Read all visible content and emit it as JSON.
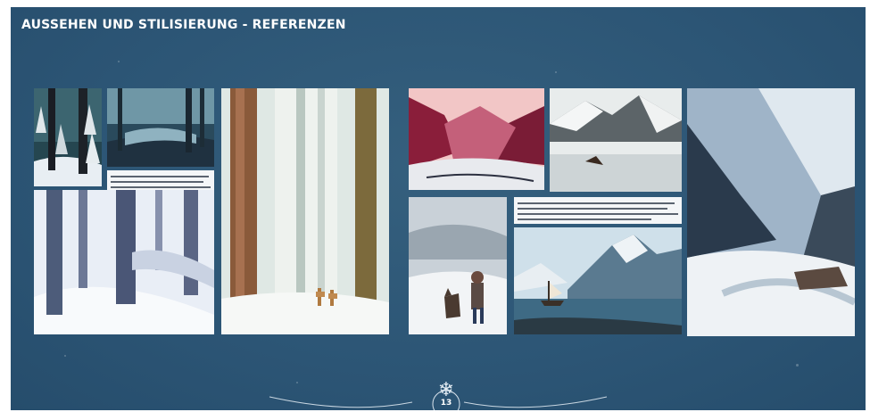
{
  "slide": {
    "title": "AUSSEHEN UND STILISIERUNG - REFERENZEN",
    "page_number": "13"
  },
  "images": [
    {
      "id": "snowy-forest-top-left"
    },
    {
      "id": "icy-forest-river"
    },
    {
      "id": "snowy-forest-slope"
    },
    {
      "id": "tall-trees-deer"
    },
    {
      "id": "red-sky-mountain-valley"
    },
    {
      "id": "snowy-mountain-lake"
    },
    {
      "id": "boy-and-dog-snow"
    },
    {
      "id": "ship-glacier-sea"
    },
    {
      "id": "snowy-mountain-river"
    }
  ],
  "colors": {
    "background": "#2c5575",
    "title": "#ffffff"
  },
  "icons": [
    "snowflake-icon"
  ]
}
